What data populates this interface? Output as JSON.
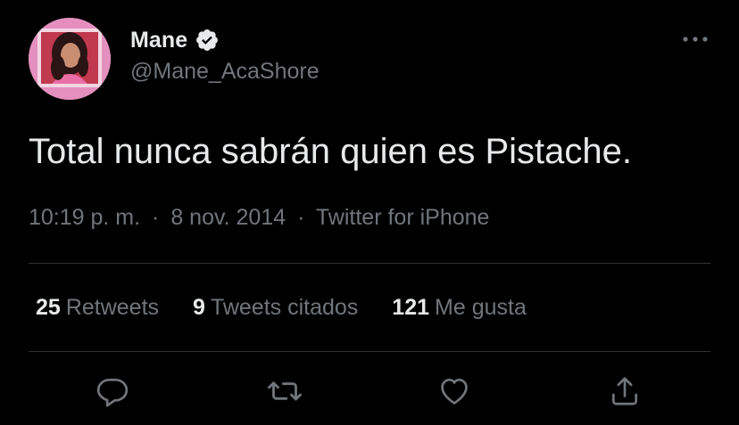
{
  "colors": {
    "background": "#000000",
    "primary_text": "#e7e9ea",
    "secondary_text": "#71767b",
    "divider": "#2f3336",
    "verified_badge": "#e7e9ea"
  },
  "author": {
    "display_name": "Mane",
    "handle": "@Mane_AcaShore",
    "verified": true,
    "avatar_icon": "profile-photo"
  },
  "tweet": {
    "text": "Total nunca sabrán quien es Pistache.",
    "time": "10:19 p. m.",
    "date": "8 nov. 2014",
    "source": "Twitter for iPhone",
    "separator": "·"
  },
  "stats": {
    "retweets": {
      "count": "25",
      "label": "Retweets"
    },
    "quotes": {
      "count": "9",
      "label": "Tweets citados"
    },
    "likes": {
      "count": "121",
      "label": "Me gusta"
    }
  },
  "actions": {
    "reply_icon": "speech-bubble-icon",
    "retweet_icon": "retweet-arrows-icon",
    "like_icon": "heart-icon",
    "share_icon": "share-upload-icon",
    "more_icon": "three-dots-icon"
  }
}
